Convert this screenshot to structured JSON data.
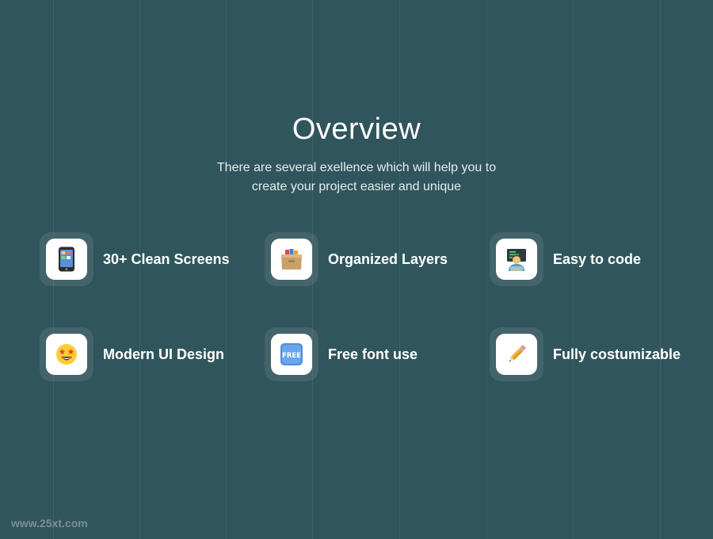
{
  "header": {
    "title": "Overview",
    "subtitle_lines": [
      "There are several exellence which will help you to",
      "create your project easier and unique"
    ]
  },
  "features": [
    {
      "label": "30+ Clean Screens",
      "icon": "mobile-phone-icon"
    },
    {
      "label": "Organized Layers",
      "icon": "card-file-box-icon"
    },
    {
      "label": "Easy to code",
      "icon": "technologist-icon"
    },
    {
      "label": "Modern UI Design",
      "icon": "star-struck-face-icon"
    },
    {
      "label": "Free font use",
      "icon": "free-button-icon"
    },
    {
      "label": "Fully costumizable",
      "icon": "pencil-icon"
    }
  ],
  "watermark": "www.25xt.com",
  "colors": {
    "background": "#30555c",
    "tile": "#3f6369",
    "text": "#ffffff"
  }
}
